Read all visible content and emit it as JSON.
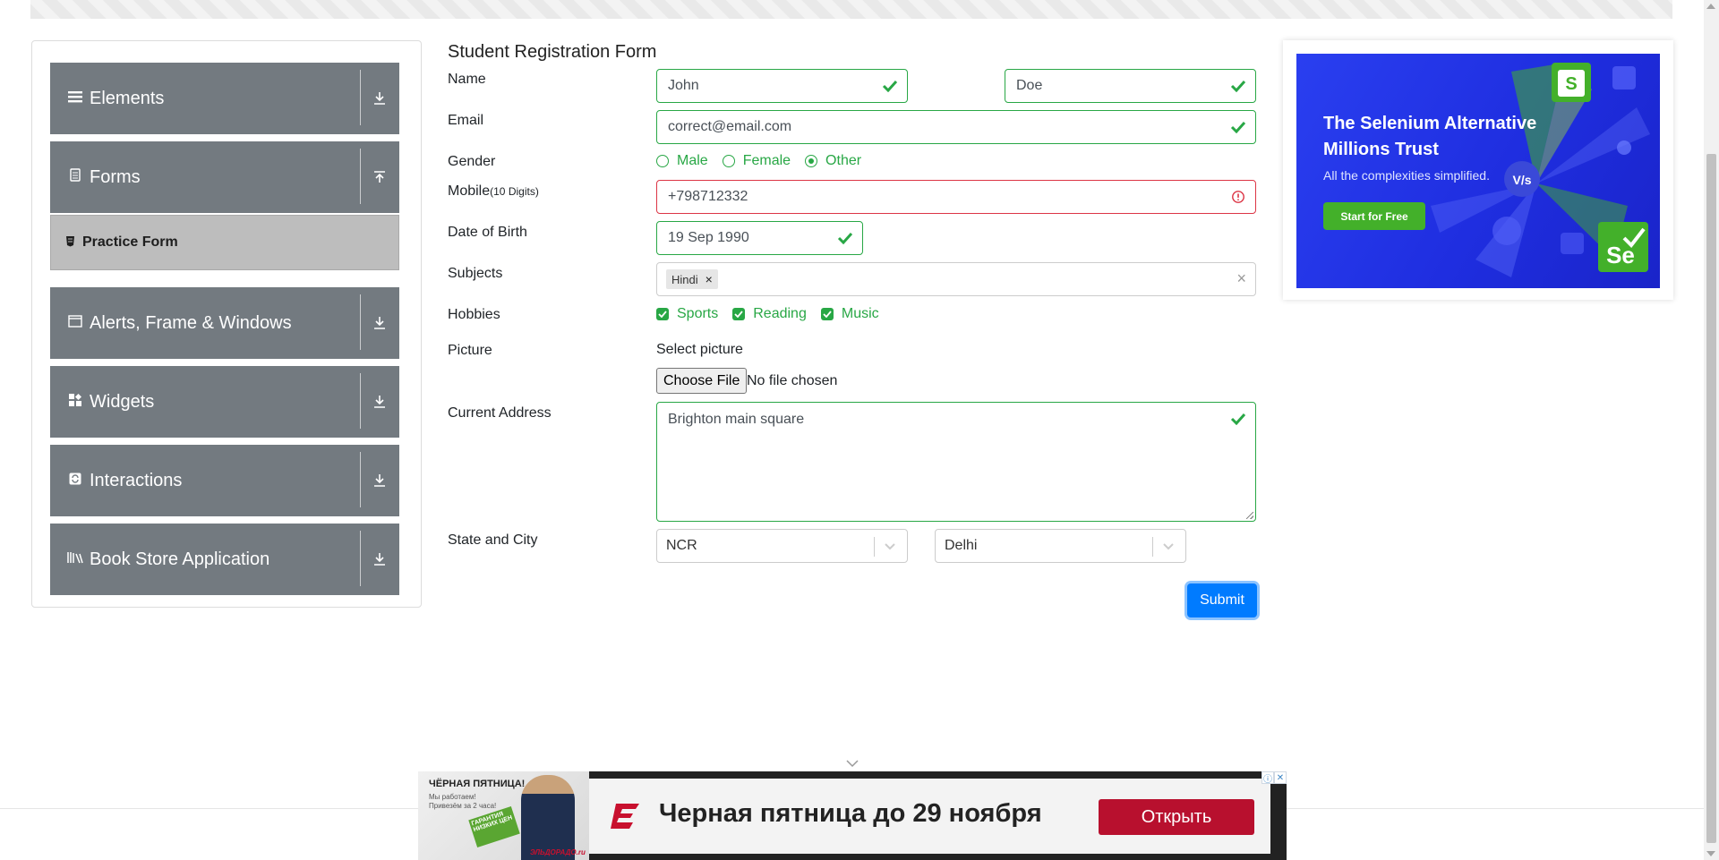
{
  "sidebar": {
    "groups": [
      {
        "label": "Elements",
        "icon": "menu-icon"
      },
      {
        "label": "Forms",
        "icon": "document-icon"
      },
      {
        "label": "Alerts, Frame & Windows",
        "icon": "window-icon"
      },
      {
        "label": "Widgets",
        "icon": "widgets-icon"
      },
      {
        "label": "Interactions",
        "icon": "sync-icon"
      },
      {
        "label": "Book Store Application",
        "icon": "books-icon"
      }
    ],
    "active_sub_item": "Practice Form"
  },
  "form": {
    "title": "Student Registration Form",
    "labels": {
      "name": "Name",
      "email": "Email",
      "gender": "Gender",
      "mobile": "Mobile",
      "mobile_hint": "(10 Digits)",
      "dob": "Date of Birth",
      "subjects": "Subjects",
      "hobbies": "Hobbies",
      "picture": "Picture",
      "address": "Current Address",
      "state_city": "State and City"
    },
    "first_name": "John",
    "last_name": "Doe",
    "email": "correct@email.com",
    "gender_options": [
      "Male",
      "Female",
      "Other"
    ],
    "gender_selected": "Other",
    "mobile": "+798712332",
    "dob": "19 Sep 1990",
    "subjects": [
      "Hindi"
    ],
    "hobbies": [
      "Sports",
      "Reading",
      "Music"
    ],
    "picture_text": "Select picture",
    "choose_file_label": "Choose File",
    "no_file_text": "No file chosen",
    "address": "Brighton main square",
    "state": "NCR",
    "city": "Delhi",
    "submit_label": "Submit"
  },
  "right_ad": {
    "title_line1": "The Selenium Alternative",
    "title_line2": "Millions Trust",
    "subtitle": "All the complexities simplified.",
    "button": "Start for Free",
    "badge_s": "S",
    "badge_vs": "V/s",
    "badge_se": "Se"
  },
  "bottom_ad": {
    "image_headline": "ЧЁРНАЯ ПЯТНИЦА!",
    "image_sub": "Мы работаем! Привезём за 2 часа!",
    "image_badge": "ГАРАНТИЯ НИЗКИХ ЦЕН",
    "image_brand": "ЭЛЬДОРАДО.ru",
    "headline": "Черная пятница до 29 ноября",
    "button": "Открыть"
  },
  "colors": {
    "sidebar_group": "#737a80",
    "valid": "#28a745",
    "invalid": "#dc3545",
    "primary": "#007bff",
    "ad_blue": "#2a3ff0",
    "ad_green": "#43b02a",
    "bottom_ad_red": "#b8102e"
  }
}
